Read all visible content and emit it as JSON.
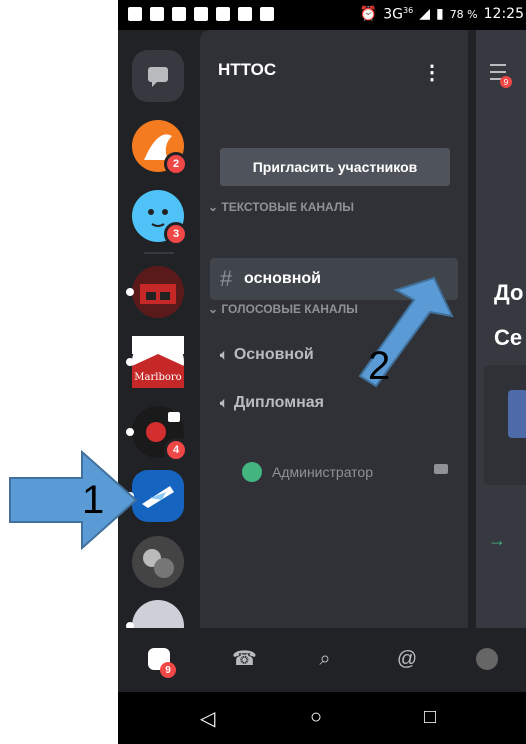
{
  "status_bar": {
    "signal": "3G",
    "signal_super": "36",
    "battery": "78 %",
    "time": "12:25"
  },
  "servers": {
    "items": [
      {
        "badge": ""
      },
      {
        "badge": "2"
      },
      {
        "badge": "3"
      },
      {
        "badge": ""
      },
      {
        "badge": ""
      },
      {
        "badge": "4"
      },
      {
        "badge": ""
      },
      {
        "badge": ""
      },
      {
        "badge": ""
      }
    ]
  },
  "guild": {
    "name": "НТТОС",
    "menu": "⋮",
    "invite_label": "Пригласить участников",
    "text_category": "ТЕКСТОВЫЕ КАНАЛЫ",
    "text_channel": "основной",
    "voice_category": "ГОЛОСОВЫЕ КАНАЛЫ",
    "voice_channels": [
      "Основной",
      "Дипломная"
    ],
    "voice_user": "Администратор"
  },
  "main_partial": {
    "title_1": "До",
    "title_2": "Се",
    "hamb_badge": "9"
  },
  "bottom_nav": {
    "home_badge": "9"
  },
  "annotations": {
    "label_1": "1",
    "label_2": "2"
  },
  "colors": {
    "accent_red": "#f04747",
    "callout_blue": "#5b9bd5",
    "online_green": "#43b581"
  }
}
